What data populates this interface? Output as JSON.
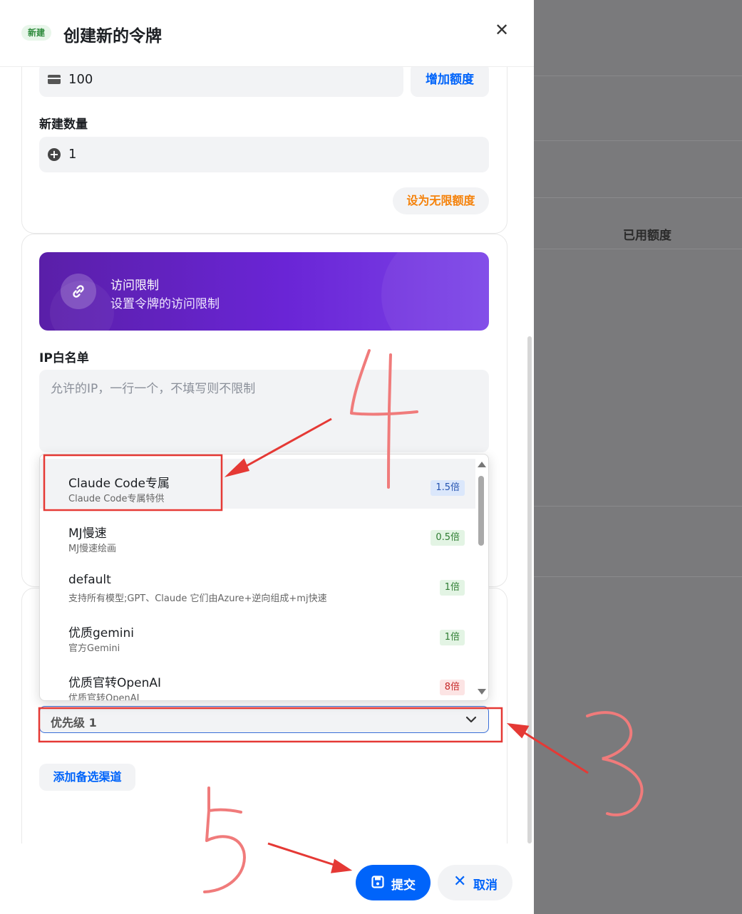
{
  "header": {
    "badge": "新建",
    "title": "创建新的令牌",
    "close_icon": "close-icon"
  },
  "quota": {
    "value": "100",
    "icon": "credit-card-icon",
    "add_button": "增加额度"
  },
  "count": {
    "label": "新建数量",
    "value": "1",
    "icon": "plus-circle-icon"
  },
  "unlimited_button": "设为无限额度",
  "access": {
    "title": "访问限制",
    "subtitle": "设置令牌的访问限制",
    "icon": "link-icon"
  },
  "ip_whitelist": {
    "label": "IP白名单",
    "placeholder": "允许的IP，一行一个，不填写则不限制"
  },
  "groups": [
    {
      "name": "Claude Code专属",
      "desc": "Claude Code专属特供",
      "ratio": "1.5倍",
      "color": "blue"
    },
    {
      "name": "MJ慢速",
      "desc": "MJ慢速绘画",
      "ratio": "0.5倍",
      "color": "green"
    },
    {
      "name": "default",
      "desc": "支持所有模型;GPT、Claude 它们由Azure+逆向组成+mj快速",
      "ratio": "1倍",
      "color": "green"
    },
    {
      "name": "优质gemini",
      "desc": "官方Gemini",
      "ratio": "1倍",
      "color": "green"
    },
    {
      "name": "优质官转OpenAI",
      "desc": "优质官转OpenAI",
      "ratio": "8倍",
      "color": "red"
    }
  ],
  "priority": {
    "value": "优先级 1"
  },
  "add_backup_channel": "添加备选渠道",
  "footer": {
    "submit": "提交",
    "cancel": "取消"
  },
  "background": {
    "used_quota_header": "已用额度"
  },
  "annotations": [
    "3",
    "4",
    "5"
  ],
  "colors": {
    "primary": "#0064fa",
    "orange": "#f5820a",
    "annotation_red": "#e53935"
  }
}
